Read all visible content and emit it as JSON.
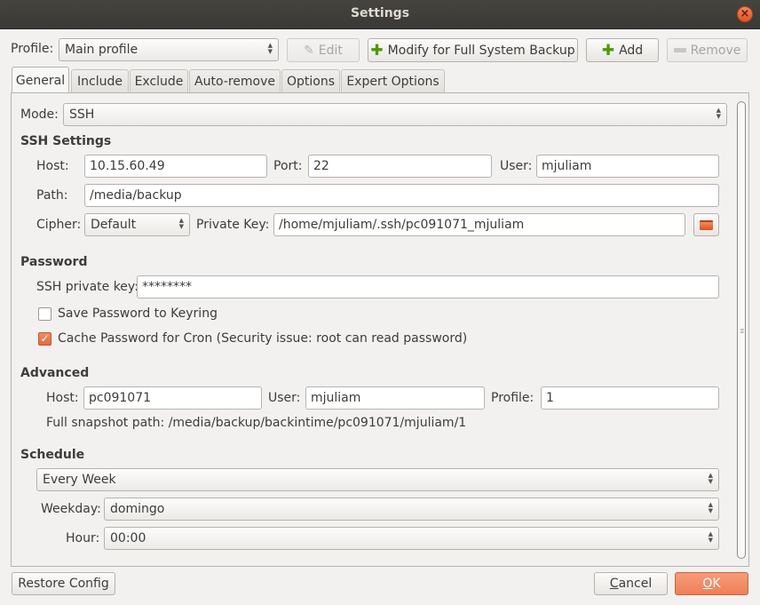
{
  "window": {
    "title": "Settings"
  },
  "profile": {
    "label": "Profile:",
    "selected": "Main profile",
    "edit_label": "Edit",
    "modify_label": "Modify for Full System Backup",
    "add_label": "Add",
    "remove_label": "Remove"
  },
  "tabs": [
    {
      "label": "General"
    },
    {
      "label": "Include"
    },
    {
      "label": "Exclude"
    },
    {
      "label": "Auto-remove"
    },
    {
      "label": "Options"
    },
    {
      "label": "Expert Options"
    }
  ],
  "mode": {
    "label": "Mode:",
    "value": "SSH"
  },
  "ssh": {
    "title": "SSH Settings",
    "host_label": "Host:",
    "host_value": "10.15.60.49",
    "port_label": "Port:",
    "port_value": "22",
    "user_label": "User:",
    "user_value": "mjuliam",
    "path_label": "Path:",
    "path_value": "/media/backup",
    "cipher_label": "Cipher:",
    "cipher_value": "Default",
    "key_label": "Private Key:",
    "key_value": "/home/mjuliam/.ssh/pc091071_mjuliam"
  },
  "password": {
    "title": "Password",
    "ssh_key_label": "SSH private key:",
    "ssh_key_value": "********",
    "keyring_label": "Save Password to Keyring",
    "keyring_checked": false,
    "cron_label": "Cache Password for Cron (Security issue: root can read password)",
    "cron_checked": true
  },
  "advanced": {
    "title": "Advanced",
    "host_label": "Host:",
    "host_value": "pc091071",
    "user_label": "User:",
    "user_value": "mjuliam",
    "profile_label": "Profile:",
    "profile_value": "1",
    "snapshot_path": "Full snapshot path: /media/backup/backintime/pc091071/mjuliam/1"
  },
  "schedule": {
    "title": "Schedule",
    "frequency": "Every Week",
    "weekday_label": "Weekday:",
    "weekday_value": "domingo",
    "hour_label": "Hour:",
    "hour_value": "00:00"
  },
  "footer": {
    "restore_label": "Restore Config",
    "cancel_label": "Cancel",
    "ok_label": "OK"
  },
  "colors": {
    "accent": "#ef7f57",
    "titlebar": "#3c3b37"
  }
}
